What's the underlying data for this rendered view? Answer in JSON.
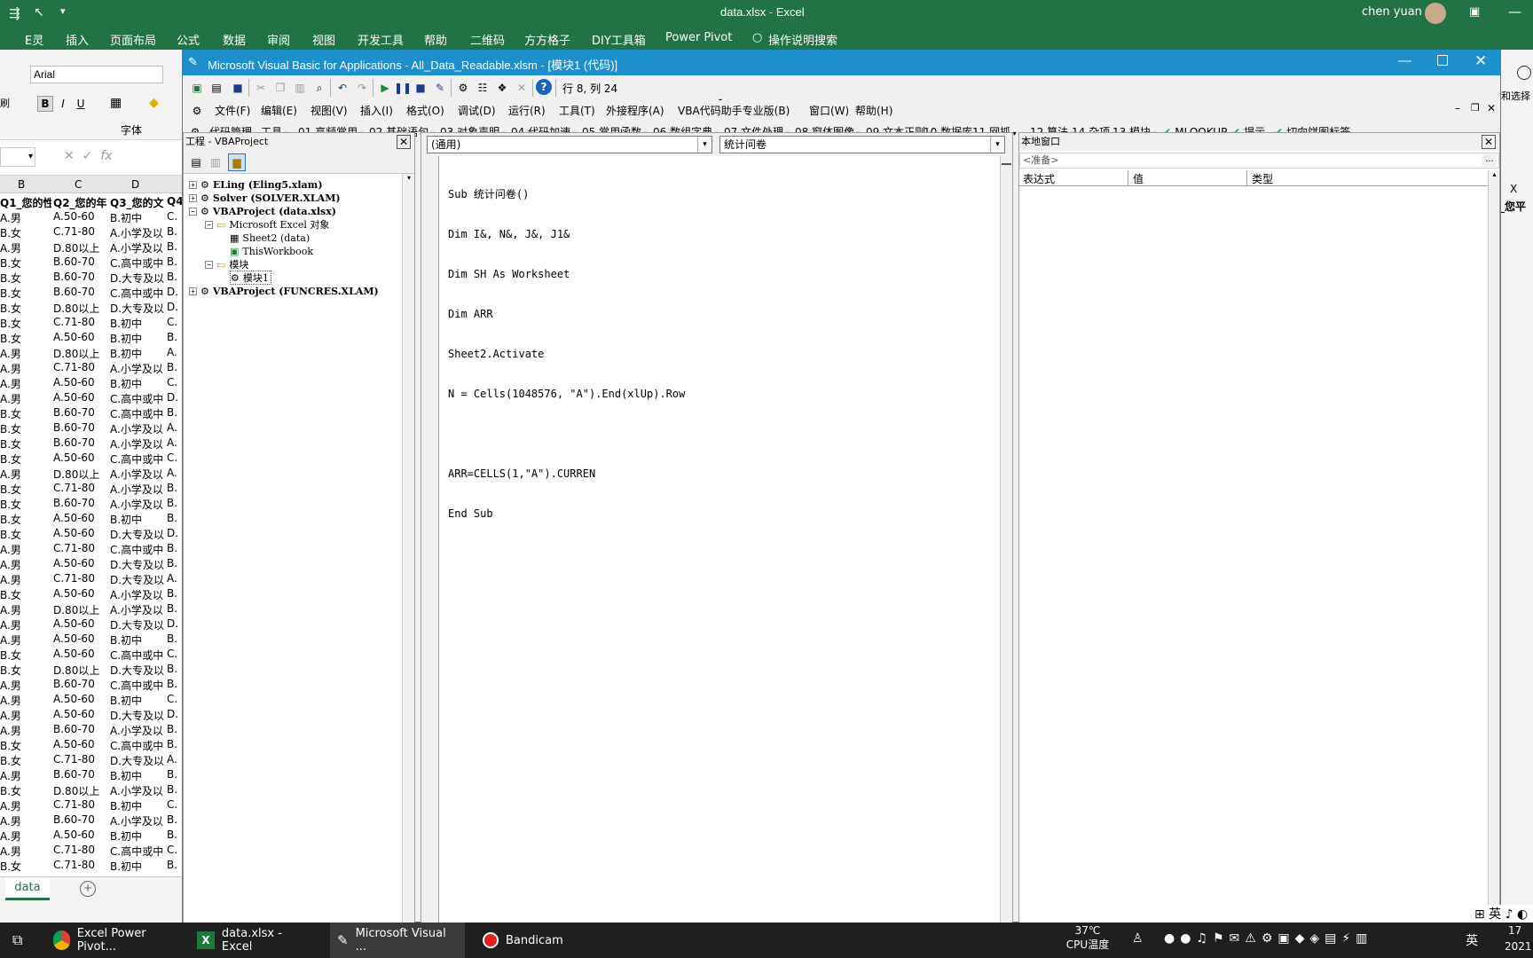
{
  "excel": {
    "window_title": "data.xlsx  -  Excel",
    "user": "chen yuan",
    "ribbon_tabs": [
      "E灵",
      "插入",
      "页面布局",
      "公式",
      "数据",
      "审阅",
      "视图",
      "开发工具",
      "帮助",
      "二维码",
      "方方格子",
      "DIY工具箱",
      "Power Pivot",
      "操作说明搜索"
    ],
    "font_name": "Arial",
    "font_group_label": "字体",
    "right_label": "和选择",
    "column_headers": [
      "B",
      "C",
      "D"
    ],
    "header_row": [
      "Q1_您的性",
      "Q2_您的年",
      "Q3_您的文",
      "Q4"
    ],
    "right_header": "_您平",
    "right_col": "X",
    "rows": [
      [
        "B.女",
        "C.71-80",
        "A.小学及以",
        "B."
      ],
      [
        "A.男",
        "D.80以上",
        "A.小学及以",
        "B."
      ],
      [
        "B.女",
        "B.60-70",
        "C.高中或中",
        "B."
      ],
      [
        "B.女",
        "B.60-70",
        "D.大专及以",
        "B."
      ],
      [
        "B.女",
        "B.60-70",
        "C.高中或中",
        "D."
      ],
      [
        "B.女",
        "D.80以上",
        "D.大专及以",
        "D."
      ],
      [
        "B.女",
        "C.71-80",
        "B.初中",
        "C."
      ],
      [
        "B.女",
        "A.50-60",
        "B.初中",
        "B."
      ],
      [
        "A.男",
        "D.80以上",
        "B.初中",
        "A."
      ],
      [
        "A.男",
        "C.71-80",
        "A.小学及以",
        "B."
      ],
      [
        "A.男",
        "A.50-60",
        "B.初中",
        "C."
      ],
      [
        "A.男",
        "A.50-60",
        "C.高中或中",
        "D."
      ],
      [
        "B.女",
        "B.60-70",
        "C.高中或中",
        "B."
      ],
      [
        "B.女",
        "B.60-70",
        "A.小学及以",
        "A."
      ],
      [
        "B.女",
        "B.60-70",
        "A.小学及以",
        "A."
      ],
      [
        "B.女",
        "A.50-60",
        "C.高中或中",
        "C."
      ],
      [
        "A.男",
        "D.80以上",
        "A.小学及以",
        "A."
      ],
      [
        "B.女",
        "C.71-80",
        "A.小学及以",
        "B."
      ],
      [
        "B.女",
        "B.60-70",
        "A.小学及以",
        "B."
      ],
      [
        "B.女",
        "A.50-60",
        "B.初中",
        "B."
      ],
      [
        "B.女",
        "A.50-60",
        "D.大专及以",
        "D."
      ],
      [
        "A.男",
        "C.71-80",
        "C.高中或中",
        "B."
      ],
      [
        "A.男",
        "A.50-60",
        "D.大专及以",
        "B."
      ],
      [
        "A.男",
        "C.71-80",
        "D.大专及以",
        "A."
      ],
      [
        "B.女",
        "A.50-60",
        "A.小学及以",
        "B."
      ],
      [
        "A.男",
        "D.80以上",
        "A.小学及以",
        "B."
      ],
      [
        "A.男",
        "A.50-60",
        "D.大专及以",
        "D."
      ],
      [
        "A.男",
        "A.50-60",
        "B.初中",
        "B."
      ],
      [
        "B.女",
        "A.50-60",
        "C.高中或中",
        "C."
      ],
      [
        "B.女",
        "D.80以上",
        "D.大专及以",
        "B."
      ],
      [
        "A.男",
        "B.60-70",
        "C.高中或中",
        "B."
      ],
      [
        "A.男",
        "A.50-60",
        "B.初中",
        "C."
      ],
      [
        "A.男",
        "A.50-60",
        "D.大专及以",
        "D."
      ],
      [
        "A.男",
        "B.60-70",
        "A.小学及以",
        "B."
      ],
      [
        "B.女",
        "A.50-60",
        "C.高中或中",
        "B."
      ],
      [
        "B.女",
        "C.71-80",
        "D.大专及以",
        "A."
      ],
      [
        "A.男",
        "B.60-70",
        "B.初中",
        "B."
      ],
      [
        "B.女",
        "D.80以上",
        "A.小学及以",
        "B."
      ],
      [
        "A.男",
        "C.71-80",
        "B.初中",
        "C."
      ],
      [
        "A.男",
        "B.60-70",
        "A.小学及以",
        "B."
      ],
      [
        "A.男",
        "A.50-60",
        "B.初中",
        "B."
      ],
      [
        "A.男",
        "C.71-80",
        "C.高中或中",
        "C."
      ],
      [
        "B.女",
        "C.71-80",
        "B.初中",
        "B."
      ]
    ],
    "first_row": [
      "A.男",
      "A.50-60",
      "B.初中",
      "C."
    ],
    "sheet_tab": "data"
  },
  "vba": {
    "title": "Microsoft Visual Basic for Applications - All_Data_Readable.xlsm - [模块1 (代码)]",
    "cursor_pos": "行 8, 列 24",
    "menu": [
      "文件(F)",
      "编辑(E)",
      "视图(V)",
      "插入(I)",
      "格式(O)",
      "调试(D)",
      "运行(R)",
      "工具(T)",
      "外接程序(A)",
      "VBA代码助手专业版(B)",
      "窗口(W)",
      "帮助(H)"
    ],
    "addin_toolbar": [
      "代码管理",
      "工具",
      "01 高频常用",
      "02 基础语句",
      "03 对象声明",
      "04 代码加速",
      "05 常用函数",
      "06 数组字典",
      "07 文件处理",
      "08 窗体图像",
      "09 文本正则",
      "10 数据库",
      "11 网抓",
      "12 算法",
      "14 杂项",
      "13 模块"
    ],
    "addin_checks": [
      "MLOOKUP",
      "提示",
      "切向饼图标签"
    ],
    "project": {
      "title": "工程 - VBAProject",
      "items": [
        "ELing (Eling5.xlam)",
        "Solver (SOLVER.XLAM)",
        "VBAProject (data.xlsx)",
        "Microsoft Excel 对象",
        "Sheet2 (data)",
        "ThisWorkbook",
        "模块",
        "模块1",
        "VBAProject (FUNCRES.XLAM)"
      ]
    },
    "code": {
      "object_combo": "(通用)",
      "proc_combo": "统计问卷",
      "lines": [
        "Sub 统计问卷()",
        "Dim I&, N&, J&, J1&",
        "Dim SH As Worksheet",
        "Dim ARR",
        "Sheet2.Activate",
        "N = Cells(1048576, \"A\").End(xlUp).Row",
        "",
        "ARR=CELLS(1,\"A\").CURREN",
        "End Sub"
      ]
    },
    "locals": {
      "title": "本地窗口",
      "status": "<准备>",
      "columns": [
        "表达式",
        "值",
        "类型"
      ],
      "more": "..."
    }
  },
  "taskbar": {
    "items": [
      "Excel Power Pivot...",
      "data.xlsx - Excel",
      "Microsoft Visual ...",
      "Bandicam"
    ],
    "temp": "37℃",
    "temp_label": "CPU温度",
    "ime": "英",
    "year": "2021",
    "time_fragment": "17"
  }
}
